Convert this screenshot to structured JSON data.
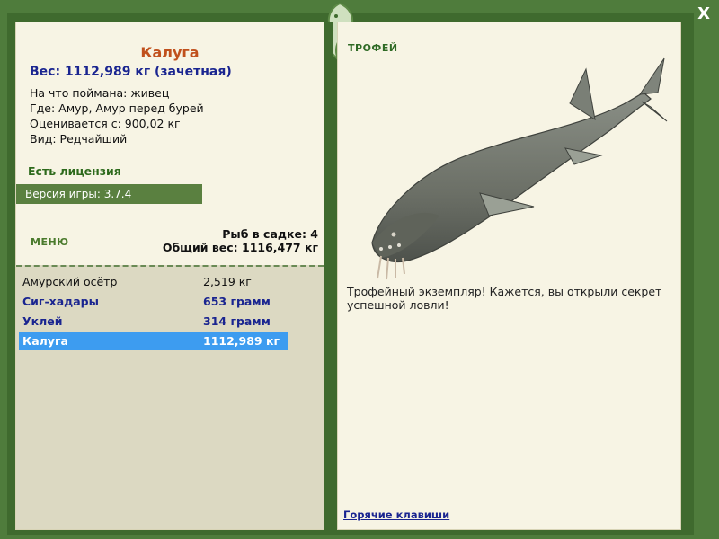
{
  "window": {
    "close_label": "X"
  },
  "left": {
    "fish_name": "Калуга",
    "weight_line": "Вес: 1112,989 кг (зачетная)",
    "info": [
      "На что поймана: живец",
      "Где: Амур, Амур перед бурей",
      "Оценивается с: 900,02 кг",
      "Вид: Редчайший"
    ],
    "license": "Есть лицензия",
    "version": "Версия игры: 3.7.4",
    "menu_label": "МЕНЮ",
    "cage_count": "Рыб в садке: 4",
    "total_weight": "Общий вес: 1116,477 кг",
    "catch_list": [
      {
        "name": "Амурский осётр",
        "weight": "2,519 кг",
        "style": "plain"
      },
      {
        "name": "Сиг-хадары",
        "weight": "653 грамм",
        "style": "bold"
      },
      {
        "name": "Уклей",
        "weight": "314 грамм",
        "style": "bold"
      },
      {
        "name": "Калуга",
        "weight": "1112,989 кг",
        "style": "selected"
      }
    ]
  },
  "right": {
    "trophy_label": "ТРОФЕЙ",
    "description": "Трофейный экземпляр! Кажется, вы открыли секрет успешной ловли!",
    "hotkeys_label": "Горячие клавиши"
  },
  "colors": {
    "frame": "#4f7c3c",
    "panel": "#f7f4e4",
    "selected_row": "#3d9cf0",
    "title": "#c0501c",
    "link": "#1a2590"
  },
  "icons": [
    "close-icon",
    "fish-logo-icon",
    "kaluga-fish-image"
  ]
}
